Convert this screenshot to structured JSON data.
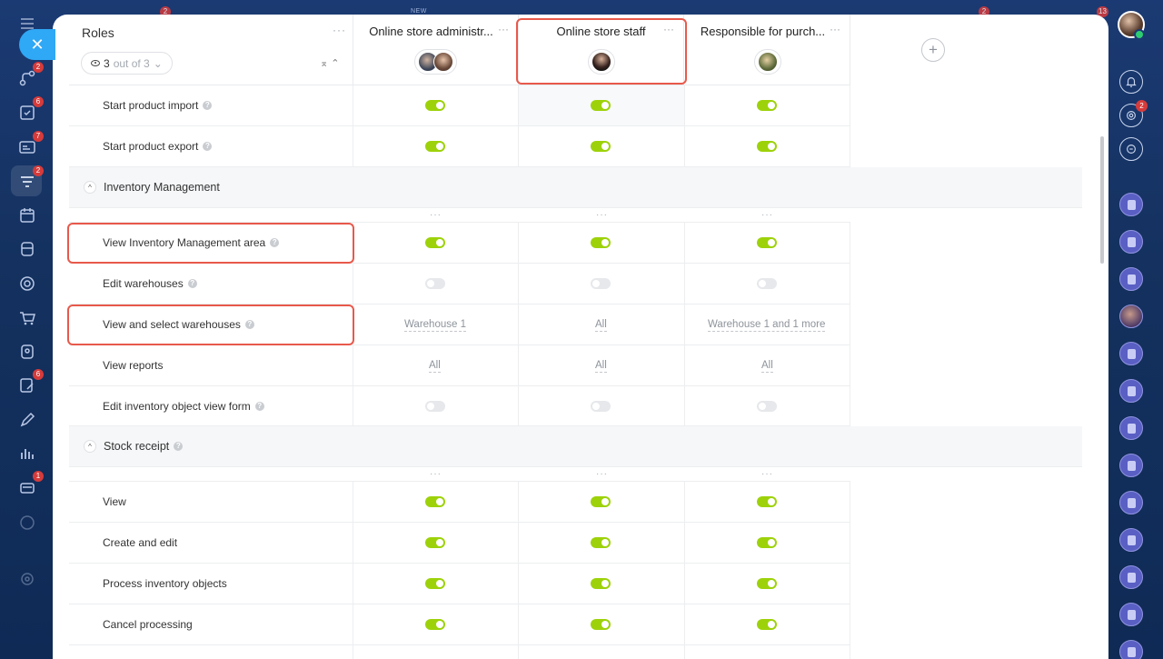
{
  "top": {
    "new_tag": "NEW",
    "badges": [
      "2",
      "2",
      "13"
    ]
  },
  "left_rail": {
    "close_icon": "close-icon",
    "items": [
      {
        "icon": "menu-icon",
        "badge": ""
      },
      {
        "icon": "flow-icon",
        "badge": "2"
      },
      {
        "icon": "task-icon",
        "badge": "6"
      },
      {
        "icon": "inbox-icon",
        "badge": "7"
      },
      {
        "icon": "filter-icon",
        "badge": "2"
      },
      {
        "icon": "calendar-icon",
        "badge": ""
      },
      {
        "icon": "building-icon",
        "badge": ""
      },
      {
        "icon": "target-icon",
        "badge": ""
      },
      {
        "icon": "cart-icon",
        "badge": ""
      },
      {
        "icon": "contact-icon",
        "badge": ""
      },
      {
        "icon": "edit-icon",
        "badge": "6"
      },
      {
        "icon": "pen-icon",
        "badge": ""
      },
      {
        "icon": "chart-icon",
        "badge": ""
      },
      {
        "icon": "stack-icon",
        "badge": "1"
      },
      {
        "icon": "help-icon",
        "badge": ""
      },
      {
        "icon": "gear-icon",
        "badge": ""
      }
    ]
  },
  "right_rail": {
    "notifications_badge": "2"
  },
  "header": {
    "roles_title": "Roles",
    "filter": {
      "count": "3",
      "suffix": "out of 3"
    },
    "roles": [
      {
        "name": "Online store administr...",
        "avatars": 2
      },
      {
        "name": "Online store staff",
        "avatars": 1
      },
      {
        "name": "Responsible for purch...",
        "avatars": 1
      }
    ]
  },
  "rows": {
    "start_import": {
      "label": "Start product import"
    },
    "start_export": {
      "label": "Start product export"
    },
    "inventory_group": {
      "label": "Inventory Management"
    },
    "view_inventory": {
      "label": "View Inventory Management area"
    },
    "edit_warehouses": {
      "label": "Edit warehouses"
    },
    "view_select_warehouses": {
      "label": "View and select warehouses",
      "values": [
        "Warehouse 1",
        "All",
        "Warehouse 1 and 1 more"
      ]
    },
    "view_reports": {
      "label": "View reports",
      "values": [
        "All",
        "All",
        "All"
      ]
    },
    "edit_form": {
      "label": "Edit inventory object view form"
    },
    "stock_group": {
      "label": "Stock receipt"
    },
    "view": {
      "label": "View"
    },
    "create_edit": {
      "label": "Create and edit"
    },
    "process": {
      "label": "Process inventory objects"
    },
    "cancel": {
      "label": "Cancel processing"
    }
  },
  "colors": {
    "toggle_on": "#9dd20a",
    "highlight": "#e8594b",
    "accent": "#2fa8f5"
  }
}
